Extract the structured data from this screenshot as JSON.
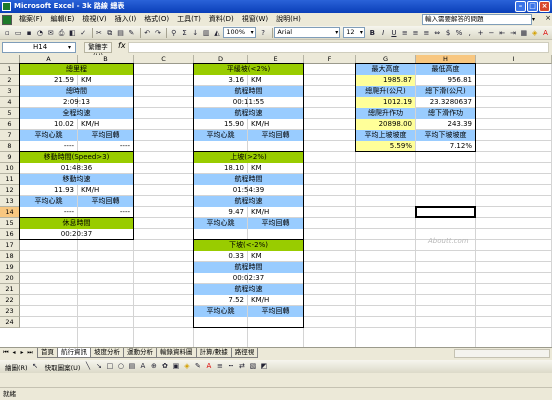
{
  "window": {
    "title": "Microsoft Excel - 3k 路線 總表"
  },
  "menu": {
    "items": [
      "檔案(F)",
      "編輯(E)",
      "檢視(V)",
      "插入(I)",
      "格式(O)",
      "工具(T)",
      "資料(D)",
      "視窗(W)",
      "說明(H)"
    ],
    "help_placeholder": "輸入需要解答的問題"
  },
  "toolbar": {
    "zoom": "100%",
    "font_name": "Arial",
    "font_size": "12"
  },
  "formula_bar": {
    "cell_ref": "H14",
    "reply_button": "繁體字(H)",
    "fx": "fx",
    "content": ""
  },
  "columns": [
    "A",
    "B",
    "C",
    "D",
    "E",
    "F",
    "G",
    "H",
    "I"
  ],
  "rows": [
    "1",
    "2",
    "3",
    "4",
    "5",
    "6",
    "7",
    "8",
    "9",
    "10",
    "11",
    "12",
    "13",
    "14",
    "15",
    "16",
    "17",
    "18",
    "19",
    "20",
    "21",
    "22",
    "23",
    "24"
  ],
  "selection": {
    "column": "H",
    "row": "14"
  },
  "left_block": {
    "total_distance_label": "總里程",
    "total_distance_value": "21.59",
    "total_distance_unit": "KM",
    "total_time_label": "總時間",
    "total_time_value": "2:09:13",
    "avg_speed_label": "全程均速",
    "avg_speed_value": "10.02",
    "avg_speed_unit": "KM/H",
    "avg_hr_label": "平均心跳",
    "avg_cadence_label": "平均回轉",
    "avg_hr_value": "----",
    "avg_cadence_value": "----",
    "moving_time_label": "移動時間(Speed>3)",
    "moving_time_value": "01:48:36",
    "moving_speed_label": "移動均速",
    "moving_speed_value": "11.93",
    "moving_speed_unit": "KM/H",
    "moving_hr_label": "平均心跳",
    "moving_cadence_label": "平均回轉",
    "moving_hr_value": "----",
    "moving_cadence_value": "----",
    "rest_time_label": "休息時間",
    "rest_time_value": "00:20:37"
  },
  "middle_block": {
    "flat_label": "平緩坡(<2%)",
    "flat_distance": "3.16",
    "flat_distance_unit": "KM",
    "flat_time_label": "航程時間",
    "flat_time_value": "00:11:55",
    "flat_speed_label": "航程均速",
    "flat_speed_value": "15.90",
    "flat_speed_unit": "KM/H",
    "flat_hr_label": "平均心跳",
    "flat_cadence_label": "平均回轉",
    "up_label": "上坡(>2%)",
    "up_distance": "18.10",
    "up_distance_unit": "KM",
    "up_time_label": "航程時間",
    "up_time_value": "01:54:39",
    "up_speed_label": "航程均速",
    "up_speed_value": "9.47",
    "up_speed_unit": "KM/H",
    "up_hr_label": "平均心跳",
    "up_cadence_label": "平均回轉",
    "down_label": "下坡(<-2%)",
    "down_distance": "0.33",
    "down_distance_unit": "KM",
    "down_time_label": "航程時間",
    "down_time_value": "00:02:37",
    "down_speed_label": "航程均速",
    "down_speed_value": "7.52",
    "down_speed_unit": "KM/H",
    "down_hr_label": "平均心跳",
    "down_cadence_label": "平均回轉"
  },
  "right_block": {
    "max_alt_label": "最大高度",
    "min_alt_label": "最低高度",
    "max_alt_value": "1985.87",
    "min_alt_value": "956.81",
    "total_climb_label": "總爬升(公尺)",
    "total_descent_label": "總下滑(公尺)",
    "total_climb_value": "1012.19",
    "total_descent_value": "23.3280637",
    "climb_work_label": "總爬升作功",
    "descent_work_label": "總下滑作功",
    "climb_work_value": "20898.00",
    "descent_work_value": "243.39",
    "avg_up_grade_label": "平均上坡坡度",
    "avg_down_grade_label": "平均下坡坡度",
    "avg_up_grade_value": "5.59%",
    "avg_down_grade_value": "7.12%"
  },
  "watermark": "Aboutt.com",
  "tabs": [
    "首頁",
    "航行資訊",
    "坡度分析",
    "運動分析",
    "輸錄資料圖",
    "計算/數據",
    "路徑視"
  ],
  "drawbar": {
    "draw_label": "繪圖(R)",
    "autoshape_label": "快取圖案(U)"
  },
  "status": {
    "text": "就緒"
  },
  "colors": {
    "green": "#99cc00",
    "blue": "#99ccff",
    "yellow": "#ffff99",
    "selection": "#f8c780"
  }
}
